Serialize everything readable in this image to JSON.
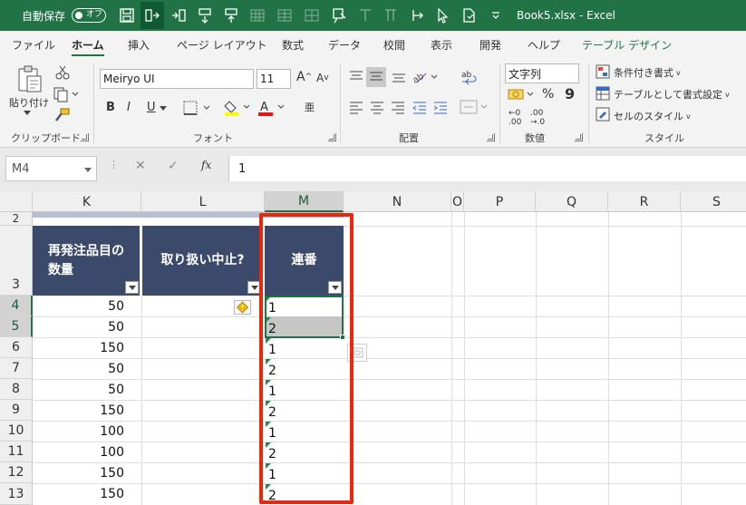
{
  "title_bar": {
    "autosave_label": "自動保存",
    "autosave_state": "オフ",
    "document_title": "Book5.xlsx  -  Excel"
  },
  "ribbon_tabs": [
    "ファイル",
    "ホーム",
    "挿入",
    "ページ レイアウト",
    "数式",
    "データ",
    "校閲",
    "表示",
    "開発",
    "ヘルプ",
    "テーブル デザイン"
  ],
  "active_tab": "ホーム",
  "ribbon": {
    "clipboard": {
      "paste_label": "貼り付け",
      "group_label": "クリップボード"
    },
    "font": {
      "font_name": "Meiryo UI",
      "font_size": "11",
      "group_label": "フォント",
      "bold": "B",
      "italic": "I",
      "underline": "U",
      "grow": "A",
      "shrink": "A",
      "phonetic": "亜"
    },
    "alignment": {
      "group_label": "配置"
    },
    "number": {
      "format": "文字列",
      "group_label": "数値",
      "percent": "%",
      "comma": "9",
      "inc_decimal_top": "←0",
      "inc_decimal_bottom": ".00",
      "dec_decimal_top": ".00",
      "dec_decimal_bottom": "→.0"
    },
    "styles": {
      "conditional": "条件付き書式",
      "as_table": "テーブルとして書式設定",
      "cell_styles": "セルのスタイル",
      "group_label": "スタイル"
    }
  },
  "formula_bar": {
    "name_box": "M4",
    "fx_label": "fx",
    "formula": "1"
  },
  "columns": [
    "K",
    "L",
    "M",
    "N",
    "O",
    "P",
    "Q",
    "R",
    "S"
  ],
  "selected_column": "M",
  "rows": [
    "2",
    "3",
    "4",
    "5",
    "6",
    "7",
    "8",
    "9",
    "10",
    "11",
    "12",
    "13"
  ],
  "selected_rows": [
    "4",
    "5"
  ],
  "table": {
    "headers": {
      "k_line1": "再発注品目の",
      "k_line2": "数量",
      "l": "取り扱い中止?",
      "m": "連番"
    },
    "k_values": [
      "50",
      "50",
      "150",
      "50",
      "50",
      "150",
      "100",
      "100",
      "150",
      "150"
    ],
    "m_values": [
      "1",
      "2",
      "1",
      "2",
      "1",
      "2",
      "1",
      "2",
      "1",
      "2"
    ]
  },
  "colors": {
    "title_bar": "#217346",
    "header_fill": "#3b4a6b",
    "annotation": "#e8280d"
  }
}
